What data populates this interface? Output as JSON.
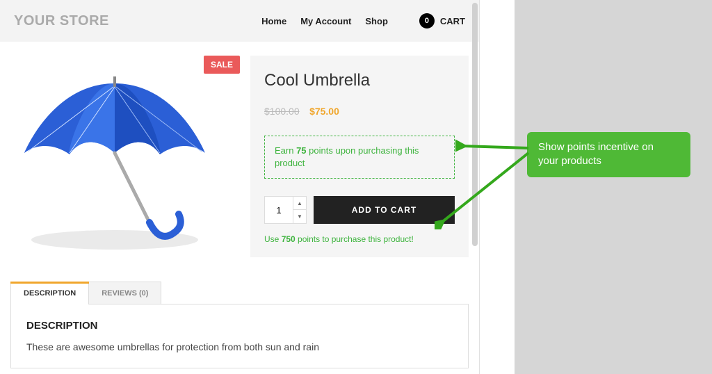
{
  "header": {
    "logo": "YOUR STORE",
    "nav": {
      "home": "Home",
      "account": "My Account",
      "shop": "Shop"
    },
    "cart": {
      "count": "0",
      "label": "CART"
    }
  },
  "sale_badge": "SALE",
  "product": {
    "title": "Cool Umbrella",
    "old_price": "$100.00",
    "price": "$75.00",
    "earn_prefix": "Earn ",
    "earn_points": "75",
    "earn_suffix": " points upon purchasing this product",
    "qty": "1",
    "add_label": "ADD TO CART",
    "use_prefix": "Use ",
    "use_points": "750",
    "use_suffix": " points to purchase this product!"
  },
  "tabs": {
    "desc_label": "DESCRIPTION",
    "reviews_label": "REVIEWS (0)",
    "desc_heading": "DESCRIPTION",
    "desc_body": "These are awesome umbrellas for protection from both sun and rain"
  },
  "callout": {
    "line1": "Show points incentive on",
    "line2": "your products"
  },
  "colors": {
    "accent": "#f0a62c",
    "green": "#3fb43f",
    "sale": "#ea5a5a",
    "callout": "#4fb936"
  }
}
